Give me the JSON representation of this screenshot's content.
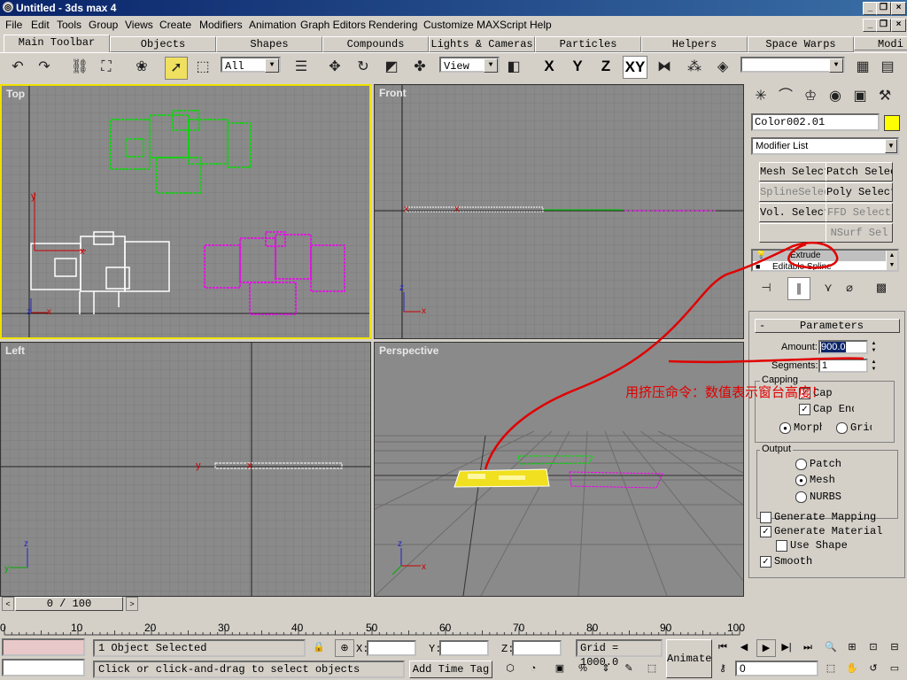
{
  "window": {
    "title": "Untitled - 3ds max 4",
    "minimize": "_",
    "restore": "❐",
    "close": "×"
  },
  "menu": [
    "File",
    "Edit",
    "Tools",
    "Group",
    "Views",
    "Create",
    "Modifiers",
    "Animation",
    "Graph Editors",
    "Rendering",
    "Customize",
    "MAXScript",
    "Help"
  ],
  "tabs": [
    "Main Toolbar",
    "Objects",
    "Shapes",
    "Compounds",
    "Lights & Cameras",
    "Particles",
    "Helpers",
    "Space Warps",
    "Modi"
  ],
  "toolbar": {
    "selection_filter": "All",
    "ref_coord": "View",
    "axis_x": "X",
    "axis_y": "Y",
    "axis_z": "Z",
    "axis_xy": "XY",
    "named_selection": ""
  },
  "viewports": {
    "top": "Top",
    "front": "Front",
    "left": "Left",
    "perspective": "Perspective"
  },
  "command_panel": {
    "object_name": "Color002.01",
    "object_color": "#ffff00",
    "modifier_list": "Modifier List",
    "modifier_buttons": [
      {
        "label": "Mesh Select",
        "enabled": true
      },
      {
        "label": "Patch Select",
        "enabled": true
      },
      {
        "label": "SplineSelect",
        "enabled": false
      },
      {
        "label": "Poly Select",
        "enabled": true
      },
      {
        "label": "Vol. Select",
        "enabled": true
      },
      {
        "label": "FFD Select",
        "enabled": false
      },
      {
        "label": "",
        "enabled": false
      },
      {
        "label": "NSurf Sel",
        "enabled": false
      }
    ],
    "stack": [
      "Extrude",
      "Editable Spline"
    ],
    "rollout_title": "Parameters",
    "rollout_minus": "-",
    "amount_label": "Amount:",
    "amount_value": "900.0",
    "segments_label": "Segments:",
    "segments_value": "1",
    "capping_label": "Capping",
    "cap_start": "Cap",
    "cap_end": "Cap End",
    "morph": "Morph",
    "grid": "Grid",
    "output_label": "Output",
    "patch": "Patch",
    "mesh": "Mesh",
    "nurbs": "NURBS",
    "generate_mapping": "Generate Mapping",
    "generate_material": "Generate Material",
    "use_shape": "Use Shape",
    "smooth": "Smooth",
    "checkbox_state": {
      "cap_start": true,
      "cap_end": true,
      "generate_mapping": false,
      "generate_material": true,
      "use_shape": false,
      "smooth": true
    },
    "radio_state": {
      "capping": "Morph",
      "output": "Mesh"
    }
  },
  "annotation": {
    "text": "用挤压命令：数值表示窗台高度！",
    "color": "#e00000"
  },
  "timeline": {
    "frame_display": "0 / 100",
    "ticks": [
      "0",
      "10",
      "20",
      "30",
      "40",
      "50",
      "60",
      "70",
      "80",
      "90",
      "100"
    ]
  },
  "status": {
    "selection": "1 Object Selected",
    "prompt": "Click or click-and-drag to select objects",
    "x_label": "X:",
    "y_label": "Y:",
    "z_label": "Z:",
    "grid": "Grid = 1000.0",
    "add_time_tag": "Add Time Tag",
    "animate": "Animate",
    "current_frame": "0"
  }
}
